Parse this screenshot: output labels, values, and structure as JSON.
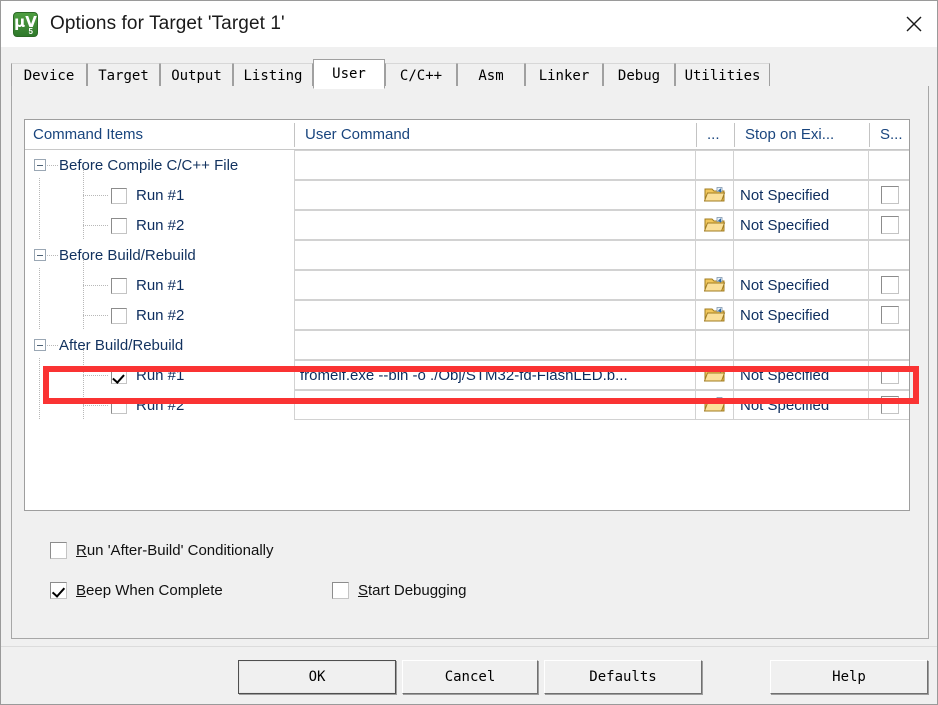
{
  "window": {
    "title": "Options for Target 'Target 1'",
    "app_icon": "keil-uvision-icon",
    "icon_mu": "µV",
    "icon_version": "5",
    "close_label": "close-icon"
  },
  "tabs": [
    {
      "label": "Device",
      "active": false
    },
    {
      "label": "Target",
      "active": false
    },
    {
      "label": "Output",
      "active": false
    },
    {
      "label": "Listing",
      "active": false
    },
    {
      "label": "User",
      "active": true
    },
    {
      "label": "C/C++",
      "active": false
    },
    {
      "label": "Asm",
      "active": false
    },
    {
      "label": "Linker",
      "active": false
    },
    {
      "label": "Debug",
      "active": false
    },
    {
      "label": "Utilities",
      "active": false
    }
  ],
  "table": {
    "headers": {
      "command_items": "Command Items",
      "user_command": "User Command",
      "dots": "...",
      "stop_on_exit": "Stop on Exi...",
      "s": "S..."
    },
    "rows": [
      {
        "type": "group",
        "label": "Before Compile C/C++ File",
        "command": "",
        "stop_on_exit": "",
        "checked": false
      },
      {
        "type": "run",
        "label": "Run #1",
        "command": "",
        "stop_on_exit": "Not Specified",
        "checked": false,
        "s_checked": false
      },
      {
        "type": "run",
        "label": "Run #2",
        "command": "",
        "stop_on_exit": "Not Specified",
        "checked": false,
        "s_checked": false
      },
      {
        "type": "group",
        "label": "Before Build/Rebuild",
        "command": "",
        "stop_on_exit": "",
        "checked": false
      },
      {
        "type": "run",
        "label": "Run #1",
        "command": "",
        "stop_on_exit": "Not Specified",
        "checked": false,
        "s_checked": false
      },
      {
        "type": "run",
        "label": "Run #2",
        "command": "",
        "stop_on_exit": "Not Specified",
        "checked": false,
        "s_checked": false
      },
      {
        "type": "group",
        "label": "After Build/Rebuild",
        "command": "",
        "stop_on_exit": "",
        "checked": false
      },
      {
        "type": "run",
        "label": "Run #1",
        "command": "fromelf.exe --bin -o ./Obj/STM32-fd-FlashLED.b...",
        "stop_on_exit": "Not Specified",
        "checked": true,
        "s_checked": false,
        "highlighted": true
      },
      {
        "type": "run",
        "label": "Run #2",
        "command": "",
        "stop_on_exit": "Not Specified",
        "checked": false,
        "s_checked": false
      }
    ]
  },
  "options": [
    {
      "name": "run-after-build-conditionally",
      "accel": "R",
      "rest": "un 'After-Build' Conditionally",
      "checked": false
    },
    {
      "name": "beep-when-complete",
      "accel": "B",
      "rest": "eep When Complete",
      "checked": true
    },
    {
      "name": "start-debugging",
      "accel": "S",
      "rest": "tart Debugging",
      "checked": false
    }
  ],
  "buttons": {
    "ok": "OK",
    "cancel": "Cancel",
    "defaults": "Defaults",
    "help": "Help"
  },
  "colors": {
    "annotation_red": "#fa3333",
    "dialog_bg": "#f0f0f0",
    "header_text": "#19457e",
    "folder_yellow": "#f0c04a"
  }
}
